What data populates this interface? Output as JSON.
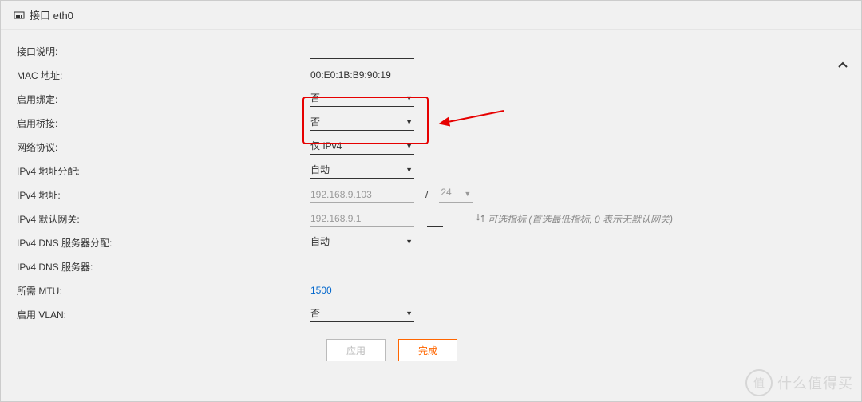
{
  "header": {
    "title": "接口 eth0"
  },
  "labels": {
    "desc": "接口说明:",
    "mac": "MAC 地址:",
    "bond": "启用绑定:",
    "bridge": "启用桥接:",
    "proto": "网络协议:",
    "ipv4assign": "IPv4 地址分配:",
    "ipv4addr": "IPv4 地址:",
    "gateway": "IPv4 默认网关:",
    "dnsassign": "IPv4 DNS 服务器分配:",
    "dnsserver": "IPv4 DNS 服务器:",
    "mtu": "所需 MTU:",
    "vlan": "启用 VLAN:"
  },
  "values": {
    "desc": "",
    "mac": "00:E0:1B:B9:90:19",
    "bond": "否",
    "bridge": "否",
    "proto": "仅 IPv4",
    "ipv4assign": "自动",
    "ipv4addr": "192.168.9.103",
    "subnet": "24",
    "gateway": "192.168.9.1",
    "dnsassign": "自动",
    "mtu": "1500",
    "vlan": "否"
  },
  "hint": {
    "gateway": "可选指标 (首选最低指标, 0 表示无默认网关)"
  },
  "buttons": {
    "apply": "应用",
    "done": "完成"
  },
  "watermark": {
    "badge": "值",
    "text": "什么值得买"
  }
}
